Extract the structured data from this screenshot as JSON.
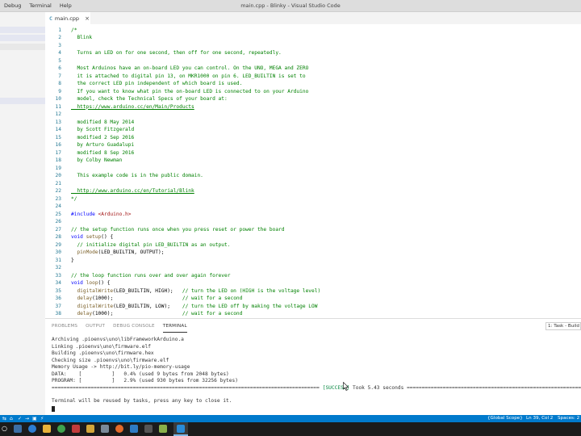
{
  "window": {
    "menu": [
      "Debug",
      "Terminal",
      "Help"
    ],
    "title": "main.cpp - Blinky - Visual Studio Code"
  },
  "tabs": [
    {
      "icon": "C",
      "label": "main.cpp",
      "close": "×"
    }
  ],
  "editor": {
    "lines": [
      {
        "n": "1",
        "t": "/*",
        "k": "com"
      },
      {
        "n": "2",
        "t": "  Blink",
        "k": "com"
      },
      {
        "n": "3",
        "t": "",
        "k": "com"
      },
      {
        "n": "4",
        "t": "  Turns an LED on for one second, then off for one second, repeatedly.",
        "k": "com"
      },
      {
        "n": "5",
        "t": "",
        "k": "com"
      },
      {
        "n": "6",
        "t": "  Most Arduinos have an on-board LED you can control. On the UNO, MEGA and ZERO",
        "k": "com"
      },
      {
        "n": "7",
        "t": "  it is attached to digital pin 13, on MKR1000 on pin 6. LED_BUILTIN is set to",
        "k": "com"
      },
      {
        "n": "8",
        "t": "  the correct LED pin independent of which board is used.",
        "k": "com"
      },
      {
        "n": "9",
        "t": "  If you want to know what pin the on-board LED is connected to on your Arduino",
        "k": "com"
      },
      {
        "n": "10",
        "t": "  model, check the Technical Specs of your board at:",
        "k": "com"
      },
      {
        "n": "11",
        "t": "  https://www.arduino.cc/en/Main/Products",
        "k": "link"
      },
      {
        "n": "12",
        "t": "",
        "k": "com"
      },
      {
        "n": "13",
        "t": "  modified 8 May 2014",
        "k": "com"
      },
      {
        "n": "14",
        "t": "  by Scott Fitzgerald",
        "k": "com"
      },
      {
        "n": "15",
        "t": "  modified 2 Sep 2016",
        "k": "com"
      },
      {
        "n": "16",
        "t": "  by Arturo Guadalupi",
        "k": "com"
      },
      {
        "n": "17",
        "t": "  modified 8 Sep 2016",
        "k": "com"
      },
      {
        "n": "18",
        "t": "  by Colby Newman",
        "k": "com"
      },
      {
        "n": "19",
        "t": "",
        "k": "com"
      },
      {
        "n": "20",
        "t": "  This example code is in the public domain.",
        "k": "com"
      },
      {
        "n": "21",
        "t": "",
        "k": "com"
      },
      {
        "n": "22",
        "t": "  http://www.arduino.cc/en/Tutorial/Blink",
        "k": "link"
      },
      {
        "n": "23",
        "t": "*/",
        "k": "com"
      },
      {
        "n": "24",
        "t": "",
        "k": "plain"
      },
      {
        "n": "25",
        "t": "#include <Arduino.h>",
        "k": "include"
      },
      {
        "n": "26",
        "t": "",
        "k": "plain"
      },
      {
        "n": "27",
        "t": "// the setup function runs once when you press reset or power the board",
        "k": "com"
      },
      {
        "n": "28",
        "t": "void setup() {",
        "k": "fndecl"
      },
      {
        "n": "29",
        "t": "  // initialize digital pin LED_BUILTIN as an output.",
        "k": "com"
      },
      {
        "n": "30",
        "t": "  pinMode(LED_BUILTIN, OUTPUT);",
        "k": "call"
      },
      {
        "n": "31",
        "t": "}",
        "k": "plain"
      },
      {
        "n": "32",
        "t": "",
        "k": "plain"
      },
      {
        "n": "33",
        "t": "// the loop function runs over and over again forever",
        "k": "com"
      },
      {
        "n": "34",
        "t": "void loop() {",
        "k": "fndecl"
      },
      {
        "n": "35",
        "t": "  digitalWrite(LED_BUILTIN, HIGH);   // turn the LED on (HIGH is the voltage level)",
        "k": "callcom"
      },
      {
        "n": "36",
        "t": "  delay(1000);                       // wait for a second",
        "k": "callcom"
      },
      {
        "n": "37",
        "t": "  digitalWrite(LED_BUILTIN, LOW);    // turn the LED off by making the voltage LOW",
        "k": "callcom"
      },
      {
        "n": "38",
        "t": "  delay(1000);                       // wait for a second",
        "k": "callcom"
      }
    ]
  },
  "panel": {
    "tabs": [
      "PROBLEMS",
      "OUTPUT",
      "DEBUG CONSOLE",
      "TERMINAL"
    ],
    "active_tab": "TERMINAL",
    "task_select": "1: Task - Build",
    "terminal_lines": [
      "Archiving .pioenvs\\uno\\libFrameworkArduino.a",
      "Linking .pioenvs\\uno\\firmware.elf",
      "Building .pioenvs\\uno\\firmware.hex",
      "Checking size .pioenvs\\uno\\firmware.elf",
      "Memory Usage -> http://bit.ly/pio-memory-usage",
      "DATA:    [          ]   0.4% (used 9 bytes from 2048 bytes)",
      "PROGRAM: [          ]   2.9% (used 930 bytes from 32256 bytes)"
    ],
    "separator_left": "=============================================================================================================",
    "success_label": "[SUCCESS]",
    "success_time": "Took 5.43 seconds",
    "separator_right": "=========================================================================",
    "reuse_message": "Terminal will be reused by tasks, press any key to close it."
  },
  "statusbar": {
    "scope": "{Global Scope}",
    "position": "Ln 39, Col 2",
    "spaces": "Spaces: 2"
  },
  "colors": {
    "statusbar": "#007acc",
    "comment": "#008000",
    "keyword": "#0000ff",
    "line_number": "#237893",
    "success": "#0b8a44"
  }
}
